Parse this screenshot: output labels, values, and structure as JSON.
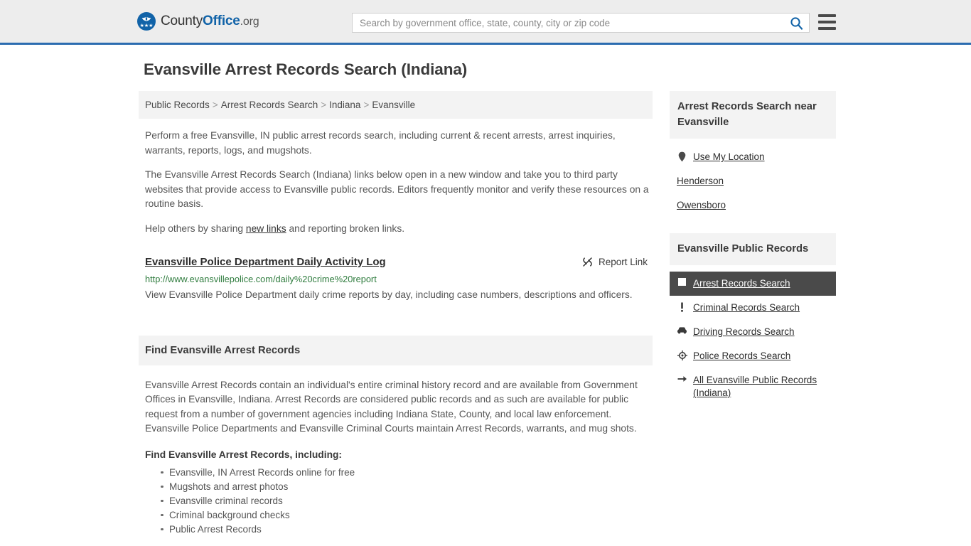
{
  "header": {
    "brand": {
      "part1": "County",
      "part2": "Office",
      "part3": ".org",
      "logo_icon": "eagle-seal-logo",
      "stars": "★★★"
    },
    "search": {
      "placeholder": "Search by government office, state, county, city or zip code",
      "value": "",
      "icon": "search-icon"
    },
    "menu_icon": "hamburger-menu-icon",
    "accent_color": "#2b6cb0"
  },
  "page": {
    "title": "Evansville Arrest Records Search (Indiana)"
  },
  "breadcrumb": {
    "items": [
      {
        "label": "Public Records"
      },
      {
        "label": "Arrest Records Search"
      },
      {
        "label": "Indiana"
      },
      {
        "label": "Evansville"
      }
    ],
    "separator": ">"
  },
  "intro": {
    "p1": "Perform a free Evansville, IN public arrest records search, including current & recent arrests, arrest inquiries, warrants, reports, logs, and mugshots.",
    "p2": "The Evansville Arrest Records Search (Indiana) links below open in a new window and take you to third party websites that provide access to Evansville public records. Editors frequently monitor and verify these resources on a routine basis.",
    "p3_before": "Help others by sharing ",
    "p3_link": "new links",
    "p3_after": " and reporting broken links."
  },
  "result": {
    "title": "Evansville Police Department Daily Activity Log",
    "url": "http://www.evansvillepolice.com/daily%20crime%20report",
    "description": "View Evansville Police Department daily crime reports by day, including case numbers, descriptions and officers.",
    "report_label": "Report Link",
    "report_icon": "broken-link-icon",
    "url_color": "#2f7c3e"
  },
  "find_section": {
    "heading": "Find Evansville Arrest Records",
    "body": "Evansville Arrest Records contain an individual's entire criminal history record and are available from Government Offices in Evansville, Indiana. Arrest Records are considered public records and as such are available for public request from a number of government agencies including Indiana State, County, and local law enforcement. Evansville Police Departments and Evansville Criminal Courts maintain Arrest Records, warrants, and mug shots.",
    "sub_heading": "Find Evansville Arrest Records, including:",
    "bullets": [
      "Evansville, IN Arrest Records online for free",
      "Mugshots and arrest photos",
      "Evansville criminal records",
      "Criminal background checks",
      "Public Arrest Records"
    ]
  },
  "sidebar": {
    "near_panel": {
      "heading": "Arrest Records Search near Evansville",
      "items": [
        {
          "label": "Use My Location",
          "icon": "map-pin-icon",
          "has_icon": true
        },
        {
          "label": "Henderson",
          "icon": "",
          "has_icon": false
        },
        {
          "label": "Owensboro",
          "icon": "",
          "has_icon": false
        }
      ]
    },
    "records_panel": {
      "heading": "Evansville Public Records",
      "items": [
        {
          "label": "Arrest Records Search",
          "icon": "id-card-icon",
          "active": true
        },
        {
          "label": "Criminal Records Search",
          "icon": "exclamation-icon",
          "active": false
        },
        {
          "label": "Driving Records Search",
          "icon": "car-icon",
          "active": false
        },
        {
          "label": "Police Records Search",
          "icon": "police-badge-icon",
          "active": false
        },
        {
          "label": "All Evansville Public Records (Indiana)",
          "icon": "arrow-right-icon",
          "active": false
        }
      ],
      "active_bg": "#4a4a4a"
    }
  }
}
